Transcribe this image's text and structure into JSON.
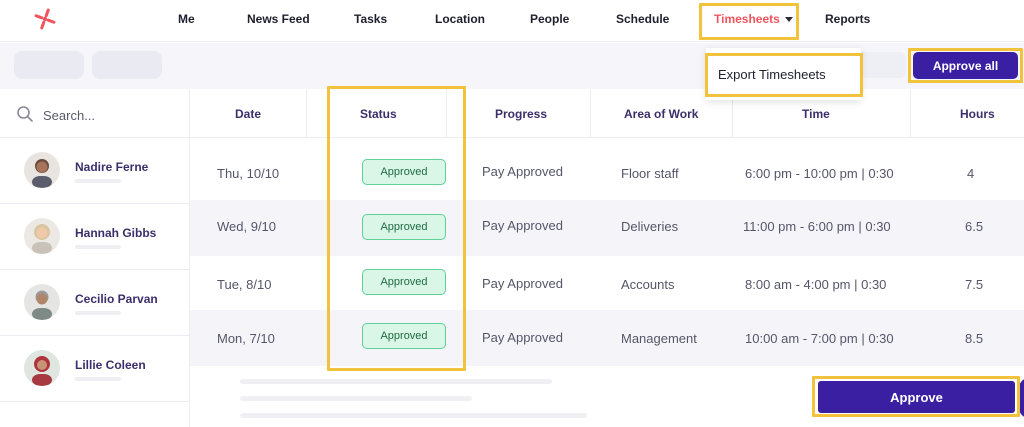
{
  "nav": {
    "items": [
      "Me",
      "News Feed",
      "Tasks",
      "Location",
      "People",
      "Schedule",
      "Timesheets",
      "Reports"
    ],
    "active": "Timesheets",
    "accent_color": "#f0555f"
  },
  "dropdown": {
    "export_label": "Export Timesheets"
  },
  "toolbar": {
    "approve_all_label": "Approve all"
  },
  "search": {
    "placeholder": "Search..."
  },
  "people": [
    {
      "name": "Nadire Ferne"
    },
    {
      "name": "Hannah Gibbs"
    },
    {
      "name": "Cecilio Parvan"
    },
    {
      "name": "Lillie Coleen"
    }
  ],
  "table": {
    "headers": [
      "Date",
      "Status",
      "Progress",
      "Area of Work",
      "Time",
      "Hours"
    ],
    "rows": [
      {
        "date": "Thu, 10/10",
        "status": "Approved",
        "progress": "Pay Approved",
        "area": "Floor staff",
        "time": "6:00 pm - 10:00 pm | 0:30",
        "hours": "4"
      },
      {
        "date": "Wed, 9/10",
        "status": "Approved",
        "progress": "Pay Approved",
        "area": "Deliveries",
        "time": "11:00 pm - 6:00 pm | 0:30",
        "hours": "6.5"
      },
      {
        "date": "Tue, 8/10",
        "status": "Approved",
        "progress": "Pay Approved",
        "area": "Accounts",
        "time": "8:00 am - 4:00 pm | 0:30",
        "hours": "7.5"
      },
      {
        "date": "Mon, 7/10",
        "status": "Approved",
        "progress": "Pay Approved",
        "area": "Management",
        "time": "10:00 am - 7:00 pm | 0:30",
        "hours": "8.5"
      }
    ]
  },
  "actions": {
    "approve_label": "Approve"
  },
  "colors": {
    "brand_purple": "#3b1fa3",
    "highlight": "#f2c23c",
    "approved_green": "#5fd196"
  }
}
